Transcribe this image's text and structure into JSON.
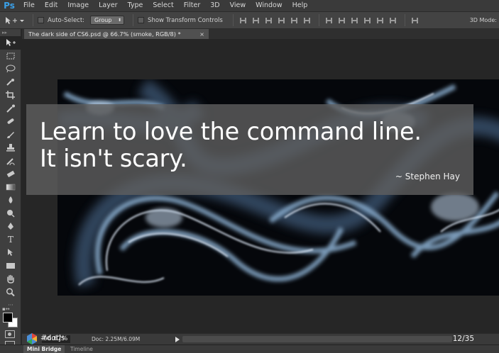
{
  "app": {
    "logo": "Ps"
  },
  "menu": [
    "File",
    "Edit",
    "Image",
    "Layer",
    "Type",
    "Select",
    "Filter",
    "3D",
    "View",
    "Window",
    "Help"
  ],
  "options_bar": {
    "auto_select_label": "Auto-Select:",
    "auto_select_value": "Group",
    "show_transform_label": "Show Transform Controls",
    "mode_3d_label": "3D Mode:"
  },
  "document_tab": {
    "title": "The dark side of CS6.psd @ 66.7% (smoke, RGB/8) *",
    "close": "×"
  },
  "slide": {
    "quote_line1": "Learn to love the command line.",
    "quote_line2": "It isn't scary.",
    "author": "~ Stephen Hay",
    "hashtag": "#dotjs",
    "slide_number": "12/35"
  },
  "status_bar": {
    "zoom": "66.67%",
    "doc_info": "Doc: 2.25M/6.09M"
  },
  "panel_tabs": [
    "Mini Bridge",
    "Timeline"
  ],
  "tools": [
    "move-tool",
    "marquee-tool",
    "lasso-tool",
    "quick-select-tool",
    "crop-tool",
    "eyedropper-tool",
    "healing-tool",
    "brush-tool",
    "clone-stamp-tool",
    "history-brush-tool",
    "eraser-tool",
    "gradient-tool",
    "blur-tool",
    "dodge-tool",
    "pen-tool",
    "type-tool",
    "path-select-tool",
    "shape-tool",
    "hand-tool",
    "zoom-tool"
  ],
  "colors": {
    "ps_blue": "#3aa0e8",
    "canvas_bg": "#262626",
    "overlay": "#5f5f5f",
    "smoke_bg": "#05070b"
  }
}
